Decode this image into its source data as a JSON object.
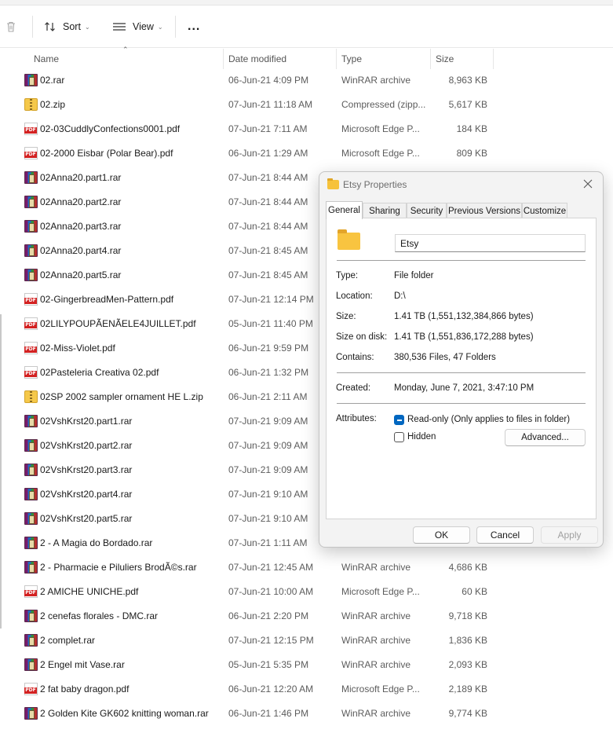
{
  "toolbar": {
    "delete_icon": "trash-icon",
    "sort_label": "Sort",
    "view_label": "View",
    "more_label": "..."
  },
  "columns": {
    "name": "Name",
    "date": "Date modified",
    "type": "Type",
    "size": "Size"
  },
  "files": [
    {
      "name": "02.rar",
      "date": "06-Jun-21 4:09 PM",
      "type": "WinRAR archive",
      "size": "8,963 KB",
      "icon": "rar"
    },
    {
      "name": "02.zip",
      "date": "07-Jun-21 11:18 AM",
      "type": "Compressed (zipp...",
      "size": "5,617 KB",
      "icon": "zip"
    },
    {
      "name": "02-03CuddlyConfections0001.pdf",
      "date": "07-Jun-21 7:11 AM",
      "type": "Microsoft Edge P...",
      "size": "184 KB",
      "icon": "pdf"
    },
    {
      "name": "02-2000 Eisbar (Polar Bear).pdf",
      "date": "06-Jun-21 1:29 AM",
      "type": "Microsoft Edge P...",
      "size": "809 KB",
      "icon": "pdf"
    },
    {
      "name": "02Anna20.part1.rar",
      "date": "07-Jun-21 8:44 AM",
      "type": "",
      "size": "",
      "icon": "rar"
    },
    {
      "name": "02Anna20.part2.rar",
      "date": "07-Jun-21 8:44 AM",
      "type": "",
      "size": "",
      "icon": "rar"
    },
    {
      "name": "02Anna20.part3.rar",
      "date": "07-Jun-21 8:44 AM",
      "type": "",
      "size": "",
      "icon": "rar"
    },
    {
      "name": "02Anna20.part4.rar",
      "date": "07-Jun-21 8:45 AM",
      "type": "",
      "size": "",
      "icon": "rar"
    },
    {
      "name": "02Anna20.part5.rar",
      "date": "07-Jun-21 8:45 AM",
      "type": "",
      "size": "",
      "icon": "rar"
    },
    {
      "name": "02-GingerbreadMen-Pattern.pdf",
      "date": "07-Jun-21 12:14 PM",
      "type": "",
      "size": "",
      "icon": "pdf"
    },
    {
      "name": "02LILYPOUPÃENÃELE4JUILLET.pdf",
      "date": "05-Jun-21 11:40 PM",
      "type": "",
      "size": "",
      "icon": "pdf"
    },
    {
      "name": "02-Miss-Violet.pdf",
      "date": "06-Jun-21 9:59 PM",
      "type": "",
      "size": "",
      "icon": "pdf"
    },
    {
      "name": "02Pasteleria Creativa 02.pdf",
      "date": "06-Jun-21 1:32 PM",
      "type": "",
      "size": "",
      "icon": "pdf"
    },
    {
      "name": "02SP 2002 sampler ornament HE L.zip",
      "date": "06-Jun-21 2:11 AM",
      "type": "",
      "size": "",
      "icon": "zip"
    },
    {
      "name": "02VshKrst20.part1.rar",
      "date": "07-Jun-21 9:09 AM",
      "type": "",
      "size": "",
      "icon": "rar"
    },
    {
      "name": "02VshKrst20.part2.rar",
      "date": "07-Jun-21 9:09 AM",
      "type": "",
      "size": "",
      "icon": "rar"
    },
    {
      "name": "02VshKrst20.part3.rar",
      "date": "07-Jun-21 9:09 AM",
      "type": "",
      "size": "",
      "icon": "rar"
    },
    {
      "name": "02VshKrst20.part4.rar",
      "date": "07-Jun-21 9:10 AM",
      "type": "",
      "size": "",
      "icon": "rar"
    },
    {
      "name": "02VshKrst20.part5.rar",
      "date": "07-Jun-21 9:10 AM",
      "type": "",
      "size": "",
      "icon": "rar"
    },
    {
      "name": "2 - A Magia do Bordado.rar",
      "date": "07-Jun-21 1:11 AM",
      "type": "",
      "size": "",
      "icon": "rar"
    },
    {
      "name": "2 - Pharmacie e Piluliers BrodÃ©s.rar",
      "date": "07-Jun-21 12:45 AM",
      "type": "WinRAR archive",
      "size": "4,686 KB",
      "icon": "rar"
    },
    {
      "name": "2 AMICHE UNICHE.pdf",
      "date": "07-Jun-21 10:00 AM",
      "type": "Microsoft Edge P...",
      "size": "60 KB",
      "icon": "pdf"
    },
    {
      "name": "2 cenefas florales - DMC.rar",
      "date": "06-Jun-21 2:20 PM",
      "type": "WinRAR archive",
      "size": "9,718 KB",
      "icon": "rar"
    },
    {
      "name": "2 complet.rar",
      "date": "07-Jun-21 12:15 PM",
      "type": "WinRAR archive",
      "size": "1,836 KB",
      "icon": "rar"
    },
    {
      "name": "2 Engel mit Vase.rar",
      "date": "05-Jun-21 5:35 PM",
      "type": "WinRAR archive",
      "size": "2,093 KB",
      "icon": "rar"
    },
    {
      "name": "2 fat baby dragon.pdf",
      "date": "06-Jun-21 12:20 AM",
      "type": "Microsoft Edge P...",
      "size": "2,189 KB",
      "icon": "pdf"
    },
    {
      "name": "2 Golden Kite GK602 knitting woman.rar",
      "date": "06-Jun-21 1:46 PM",
      "type": "WinRAR archive",
      "size": "9,774 KB",
      "icon": "rar"
    }
  ],
  "dialog": {
    "title": "Etsy Properties",
    "tabs": [
      "General",
      "Sharing",
      "Security",
      "Previous Versions",
      "Customize"
    ],
    "active_tab": "General",
    "folder_name": "Etsy",
    "type_label": "Type:",
    "type_value": "File folder",
    "location_label": "Location:",
    "location_value": "D:\\",
    "size_label": "Size:",
    "size_value": "1.41 TB (1,551,132,384,866 bytes)",
    "size_on_disk_label": "Size on disk:",
    "size_on_disk_value": "1.41 TB (1,551,836,172,288 bytes)",
    "contains_label": "Contains:",
    "contains_value": "380,536 Files, 47 Folders",
    "created_label": "Created:",
    "created_value": "Monday, June 7, 2021, 3:47:10 PM",
    "attributes_label": "Attributes:",
    "readonly_label": "Read-only (Only applies to files in folder)",
    "readonly_checked": true,
    "hidden_label": "Hidden",
    "hidden_checked": false,
    "advanced_label": "Advanced...",
    "ok_label": "OK",
    "cancel_label": "Cancel",
    "apply_label": "Apply"
  }
}
